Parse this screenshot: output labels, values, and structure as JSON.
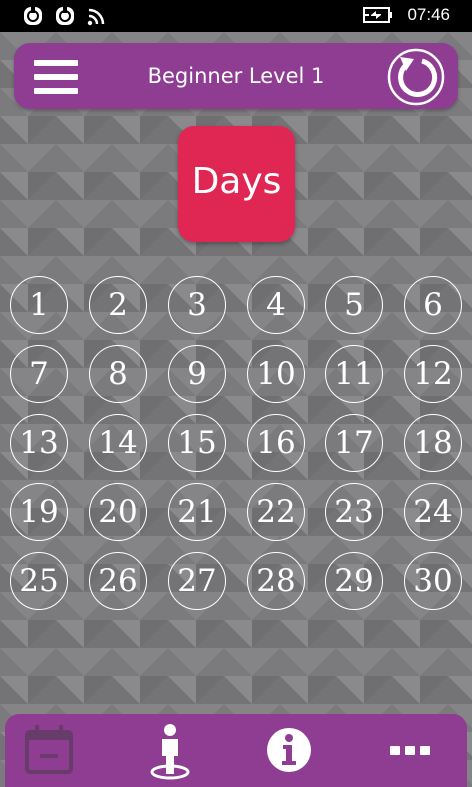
{
  "status_bar": {
    "time": "07:46",
    "icons": [
      "notification-app-icon",
      "notification-app-icon",
      "wifi-icon",
      "battery-charging-icon"
    ]
  },
  "header": {
    "title": "Beginner Level 1",
    "menu_icon": "hamburger-menu-icon",
    "refresh_icon": "refresh-icon"
  },
  "badge": {
    "label": "Days",
    "color": "#e02753"
  },
  "days": [
    "1",
    "2",
    "3",
    "4",
    "5",
    "6",
    "7",
    "8",
    "9",
    "10",
    "11",
    "12",
    "13",
    "14",
    "15",
    "16",
    "17",
    "18",
    "19",
    "20",
    "21",
    "22",
    "23",
    "24",
    "25",
    "26",
    "27",
    "28",
    "29",
    "30"
  ],
  "bottom_nav": {
    "items": [
      {
        "icon": "calendar-icon"
      },
      {
        "icon": "person-icon"
      },
      {
        "icon": "info-icon"
      },
      {
        "icon": "more-icon"
      }
    ]
  },
  "colors": {
    "accent": "#8e3d93",
    "background": "#7d7d7f",
    "badge": "#e02753"
  }
}
